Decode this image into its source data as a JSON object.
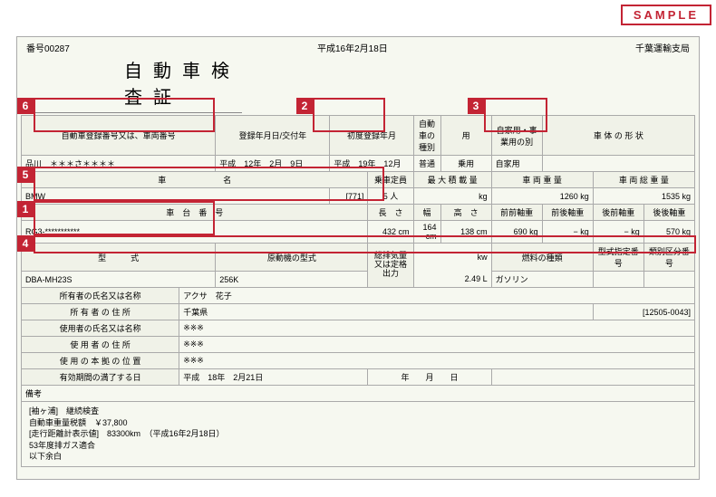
{
  "sample": "SAMPLE",
  "serial": "番号00287",
  "issue_date": "平成16年2月18日",
  "office": "千葉運輸支局",
  "title": "自動車検査証",
  "h": {
    "reg_no": "自動車登録番号又は、車両番号",
    "reg_date": "登録年月日/交付年",
    "first_reg": "初度登録年月",
    "class": "自動車の種別",
    "use": "用",
    "priv_biz": "自家用・事業用の別",
    "body": "車 体 の 形 状",
    "car_name": "車　　　　　　　名",
    "cap": "乗車定員",
    "max_load": "最 大 積 載 量",
    "veh_wt": "車 両 重 量",
    "gvw": "車 両 総 重 量",
    "chassis": "車　台　番　号",
    "len": "長　さ",
    "wid": "幅",
    "hei": "高　さ",
    "ff": "前前軸重",
    "fr": "前後軸重",
    "rf": "後前軸重",
    "rr": "後後軸重",
    "model": "型　　　式",
    "engine": "原動機の型式",
    "disp": "総排気量又は定格出力",
    "fuel": "燃料の種類",
    "type_code": "型式指定番号",
    "class_code": "類別区分番号",
    "owner": "所有者の氏名又は名称",
    "owner_addr": "所 有 者 の 住 所",
    "user": "使用者の氏名又は名称",
    "user_addr": "使 用 者 の 住 所",
    "base": "使 用 の 本 拠 の 位 置",
    "expiry": "有効期間の満了する日",
    "remarks": "備考"
  },
  "v": {
    "reg_no": "品川　＊＊＊さ＊＊＊＊",
    "reg_date": "平成　12年　2月　9日",
    "first_reg": "平成　19年　12月",
    "class": "普通",
    "use": "乗用",
    "priv_biz": "自家用",
    "body": "",
    "car_name": "BMW",
    "car_code": "[771]",
    "cap": "5 人",
    "max_load": "kg",
    "veh_wt": "1260 kg",
    "gvw": "1535 kg",
    "chassis": "RG3-***********",
    "len": "432 cm",
    "wid": "164 cm",
    "hei": "138 cm",
    "ff": "690 kg",
    "fr": "− kg",
    "rf": "− kg",
    "rr": "570 kg",
    "model": "DBA-MH23S",
    "engine": "256K",
    "disp_kw": "kw",
    "disp_l": "2.49 L",
    "fuel": "ガソリン",
    "owner": "アクサ　花子",
    "owner_addr": "千葉県",
    "owner_code": "[12505-0043]",
    "user": "※※※",
    "user_addr": "※※※",
    "base": "※※※",
    "expiry1": "平成　18年　2月21日",
    "expiry2": "年　　月　　日"
  },
  "remarks": [
    "[袖ヶ浦]　継続検査",
    "自動車重量税額　￥37,800",
    "[走行距離計表示値]　83300km　（平成16年2月18日）",
    "53年度排ガス適合",
    "以下余白"
  ],
  "callouts": {
    "1": "1",
    "2": "2",
    "3": "3",
    "4": "4",
    "5": "5",
    "6": "6"
  }
}
